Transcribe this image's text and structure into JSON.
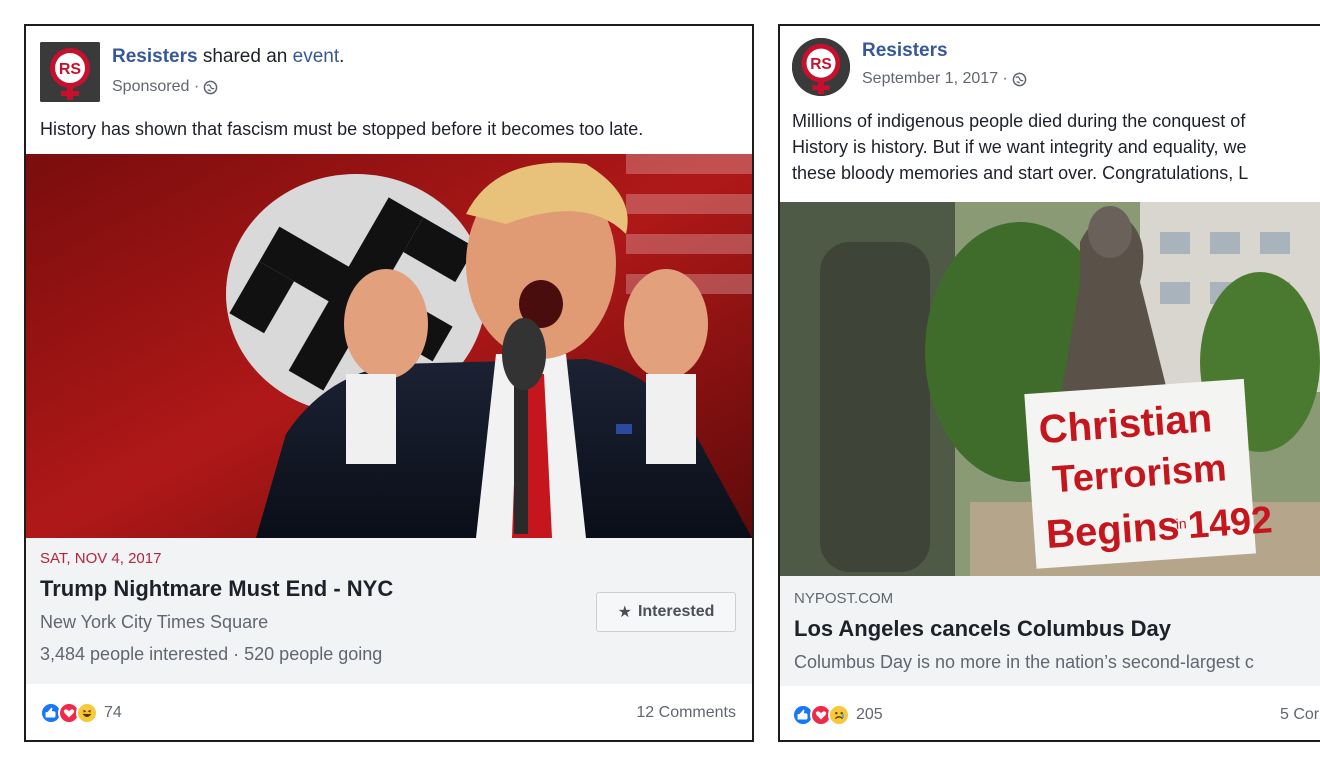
{
  "posts": [
    {
      "page_name": "Resisters",
      "shared_text": " shared an ",
      "shared_link": "event",
      "shared_end": ".",
      "meta": "Sponsored ·",
      "text_lines": [
        "History has shown that fascism must be stopped before it becomes too late."
      ],
      "event": {
        "date": "SAT, NOV 4, 2017",
        "title": "Trump Nightmare Must End - NYC",
        "location": "New York City Times Square",
        "stats": "3,484 people interested · 520 people going",
        "button_label": "Interested",
        "button_icon": "star-icon"
      },
      "reactions": {
        "icons": [
          "like-icon",
          "love-icon",
          "haha-icon"
        ],
        "count": "74"
      },
      "comments": "12 Comments"
    },
    {
      "page_name": "Resisters",
      "meta": "September 1, 2017 ·",
      "text_lines": [
        "Millions of indigenous people died during the conquest of",
        "History is history. But if we want integrity and equality, we",
        "these bloody memories and start over. Congratulations, L"
      ],
      "link": {
        "domain": "NYPOST.COM",
        "title": "Los Angeles cancels Columbus Day",
        "description": "Columbus Day is no more in the nation’s second-largest c"
      },
      "image_sign": [
        "Christian",
        "Terrorism",
        "Begins",
        "in",
        "1492"
      ],
      "reactions": {
        "icons": [
          "like-icon",
          "love-icon",
          "sad-icon"
        ],
        "count": "205"
      },
      "comments": "5 Cor"
    }
  ],
  "avatar_text": "RS",
  "colors": {
    "link_blue": "#365899",
    "event_date_red": "#b3253c",
    "card_bg": "#f2f3f5",
    "muted": "#616770"
  }
}
